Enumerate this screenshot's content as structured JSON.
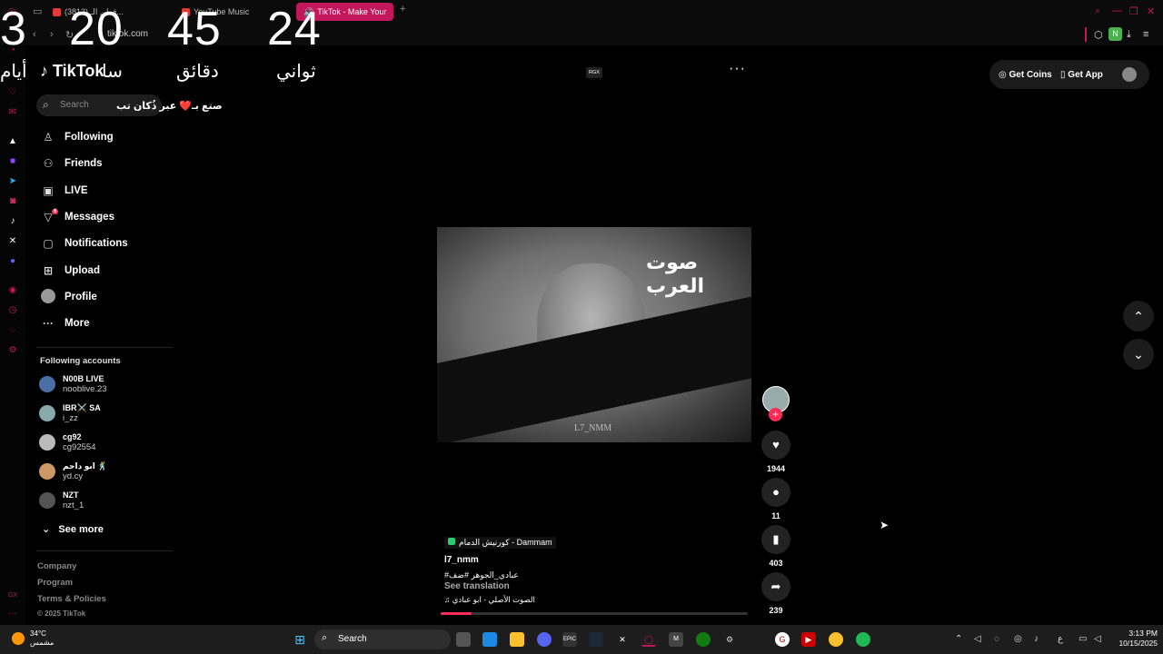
{
  "browser": {
    "tabs": [
      {
        "label": "(3813) قطن الـ..."
      },
      {
        "label": "YouTube Music"
      },
      {
        "label": "TikTok - Make Your"
      }
    ],
    "new_tab": "+",
    "url": "tiktok.com"
  },
  "countdown": {
    "days": "3",
    "hours": "20",
    "minutes": "45",
    "seconds": "24",
    "label_days": "أيام",
    "label_hours": "سا",
    "label_minutes": "دقائق",
    "label_seconds": "ثواني"
  },
  "tiktok": {
    "logo": "TikTok",
    "search_placeholder": "Search",
    "overlay_text": "صتع بـ❤️ عبر ذُكان تب",
    "nav": [
      {
        "label": "Following",
        "icon": "following-icon"
      },
      {
        "label": "Friends",
        "icon": "friends-icon"
      },
      {
        "label": "LIVE",
        "icon": "live-icon"
      },
      {
        "label": "Messages",
        "icon": "messages-icon",
        "badge": "6"
      },
      {
        "label": "Notifications",
        "icon": "notifications-icon"
      },
      {
        "label": "Upload",
        "icon": "upload-icon"
      },
      {
        "label": "Profile",
        "icon": "profile-icon"
      },
      {
        "label": "More",
        "icon": "more-icon"
      }
    ],
    "following_title": "Following accounts",
    "accounts": [
      {
        "name": "N00B LIVE",
        "handle": "nooblive.23"
      },
      {
        "name": "IBR⚔️ SA",
        "handle": "i_zz"
      },
      {
        "name": "cg92",
        "handle": "cg92554"
      },
      {
        "name": "ابو داحم 🕺",
        "handle": "yd.cy"
      },
      {
        "name": "NZT",
        "handle": "nzt_1"
      }
    ],
    "see_more": "See more",
    "footer": [
      "Company",
      "Program",
      "Terms & Policies",
      "© 2025 TikTok"
    ],
    "get_coins": "Get Coins",
    "get_app": "Get App",
    "rgx": "RGX",
    "more_dots": "···"
  },
  "video": {
    "watermark": "L7_NMM",
    "logo_text": "صوت العرب",
    "location": "كورنيش الدمام - Dammam",
    "username": "l7_nmm",
    "caption": "#عبادي_الجوهر #ضف",
    "see_translation": "See translation",
    "music": "الصوت الأصلي - ابو عبادي",
    "likes": "1944",
    "comments": "11",
    "saves": "403",
    "shares": "239",
    "progress": 0.1
  },
  "taskbar": {
    "temp": "34°C",
    "weather_desc": "مشمس",
    "search": "Search",
    "time": "3:13 PM",
    "date": "10/15/2025",
    "lang": "ع"
  }
}
